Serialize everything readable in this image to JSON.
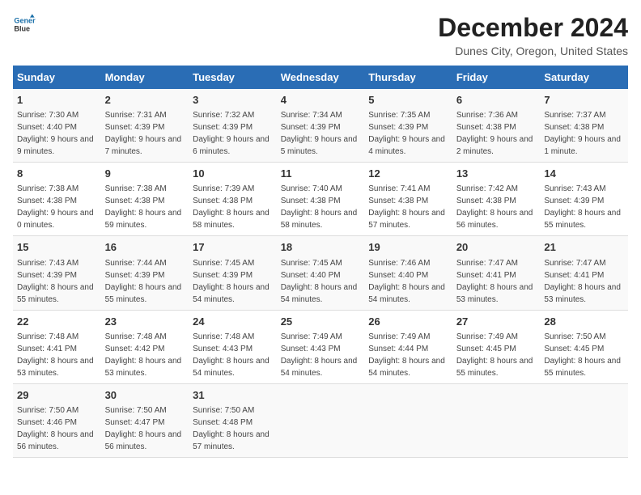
{
  "header": {
    "logo_line1": "General",
    "logo_line2": "Blue",
    "title": "December 2024",
    "subtitle": "Dunes City, Oregon, United States"
  },
  "days_of_week": [
    "Sunday",
    "Monday",
    "Tuesday",
    "Wednesday",
    "Thursday",
    "Friday",
    "Saturday"
  ],
  "weeks": [
    [
      {
        "day": "1",
        "sunrise": "7:30 AM",
        "sunset": "4:40 PM",
        "daylight": "9 hours and 9 minutes."
      },
      {
        "day": "2",
        "sunrise": "7:31 AM",
        "sunset": "4:39 PM",
        "daylight": "9 hours and 7 minutes."
      },
      {
        "day": "3",
        "sunrise": "7:32 AM",
        "sunset": "4:39 PM",
        "daylight": "9 hours and 6 minutes."
      },
      {
        "day": "4",
        "sunrise": "7:34 AM",
        "sunset": "4:39 PM",
        "daylight": "9 hours and 5 minutes."
      },
      {
        "day": "5",
        "sunrise": "7:35 AM",
        "sunset": "4:39 PM",
        "daylight": "9 hours and 4 minutes."
      },
      {
        "day": "6",
        "sunrise": "7:36 AM",
        "sunset": "4:38 PM",
        "daylight": "9 hours and 2 minutes."
      },
      {
        "day": "7",
        "sunrise": "7:37 AM",
        "sunset": "4:38 PM",
        "daylight": "9 hours and 1 minute."
      }
    ],
    [
      {
        "day": "8",
        "sunrise": "7:38 AM",
        "sunset": "4:38 PM",
        "daylight": "9 hours and 0 minutes."
      },
      {
        "day": "9",
        "sunrise": "7:38 AM",
        "sunset": "4:38 PM",
        "daylight": "8 hours and 59 minutes."
      },
      {
        "day": "10",
        "sunrise": "7:39 AM",
        "sunset": "4:38 PM",
        "daylight": "8 hours and 58 minutes."
      },
      {
        "day": "11",
        "sunrise": "7:40 AM",
        "sunset": "4:38 PM",
        "daylight": "8 hours and 58 minutes."
      },
      {
        "day": "12",
        "sunrise": "7:41 AM",
        "sunset": "4:38 PM",
        "daylight": "8 hours and 57 minutes."
      },
      {
        "day": "13",
        "sunrise": "7:42 AM",
        "sunset": "4:38 PM",
        "daylight": "8 hours and 56 minutes."
      },
      {
        "day": "14",
        "sunrise": "7:43 AM",
        "sunset": "4:39 PM",
        "daylight": "8 hours and 55 minutes."
      }
    ],
    [
      {
        "day": "15",
        "sunrise": "7:43 AM",
        "sunset": "4:39 PM",
        "daylight": "8 hours and 55 minutes."
      },
      {
        "day": "16",
        "sunrise": "7:44 AM",
        "sunset": "4:39 PM",
        "daylight": "8 hours and 55 minutes."
      },
      {
        "day": "17",
        "sunrise": "7:45 AM",
        "sunset": "4:39 PM",
        "daylight": "8 hours and 54 minutes."
      },
      {
        "day": "18",
        "sunrise": "7:45 AM",
        "sunset": "4:40 PM",
        "daylight": "8 hours and 54 minutes."
      },
      {
        "day": "19",
        "sunrise": "7:46 AM",
        "sunset": "4:40 PM",
        "daylight": "8 hours and 54 minutes."
      },
      {
        "day": "20",
        "sunrise": "7:47 AM",
        "sunset": "4:41 PM",
        "daylight": "8 hours and 53 minutes."
      },
      {
        "day": "21",
        "sunrise": "7:47 AM",
        "sunset": "4:41 PM",
        "daylight": "8 hours and 53 minutes."
      }
    ],
    [
      {
        "day": "22",
        "sunrise": "7:48 AM",
        "sunset": "4:41 PM",
        "daylight": "8 hours and 53 minutes."
      },
      {
        "day": "23",
        "sunrise": "7:48 AM",
        "sunset": "4:42 PM",
        "daylight": "8 hours and 53 minutes."
      },
      {
        "day": "24",
        "sunrise": "7:48 AM",
        "sunset": "4:43 PM",
        "daylight": "8 hours and 54 minutes."
      },
      {
        "day": "25",
        "sunrise": "7:49 AM",
        "sunset": "4:43 PM",
        "daylight": "8 hours and 54 minutes."
      },
      {
        "day": "26",
        "sunrise": "7:49 AM",
        "sunset": "4:44 PM",
        "daylight": "8 hours and 54 minutes."
      },
      {
        "day": "27",
        "sunrise": "7:49 AM",
        "sunset": "4:45 PM",
        "daylight": "8 hours and 55 minutes."
      },
      {
        "day": "28",
        "sunrise": "7:50 AM",
        "sunset": "4:45 PM",
        "daylight": "8 hours and 55 minutes."
      }
    ],
    [
      {
        "day": "29",
        "sunrise": "7:50 AM",
        "sunset": "4:46 PM",
        "daylight": "8 hours and 56 minutes."
      },
      {
        "day": "30",
        "sunrise": "7:50 AM",
        "sunset": "4:47 PM",
        "daylight": "8 hours and 56 minutes."
      },
      {
        "day": "31",
        "sunrise": "7:50 AM",
        "sunset": "4:48 PM",
        "daylight": "8 hours and 57 minutes."
      },
      {
        "day": "",
        "sunrise": "",
        "sunset": "",
        "daylight": ""
      },
      {
        "day": "",
        "sunrise": "",
        "sunset": "",
        "daylight": ""
      },
      {
        "day": "",
        "sunrise": "",
        "sunset": "",
        "daylight": ""
      },
      {
        "day": "",
        "sunrise": "",
        "sunset": "",
        "daylight": ""
      }
    ]
  ]
}
